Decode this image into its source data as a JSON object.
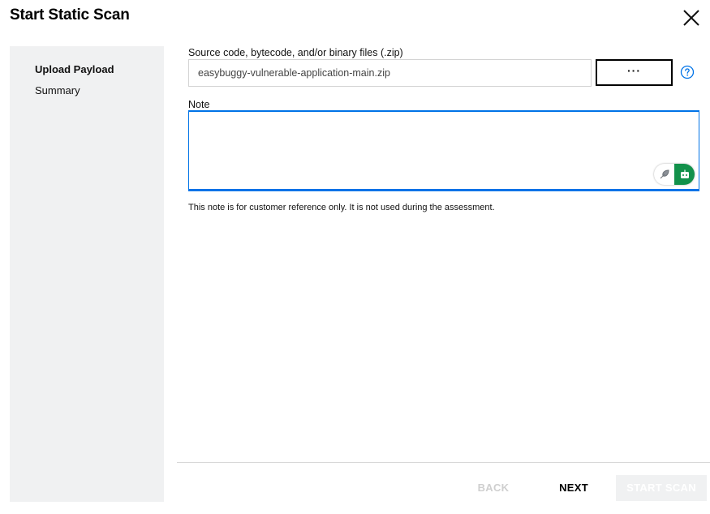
{
  "dialog": {
    "title": "Start Static Scan",
    "close_icon": "close-icon"
  },
  "sidebar": {
    "items": [
      {
        "label": "Upload Payload",
        "active": true
      },
      {
        "label": "Summary",
        "active": false
      }
    ]
  },
  "upload": {
    "label": "Source code, bytecode, and/or binary files (.zip)",
    "file_value": "easybuggy-vulnerable-application-main.zip",
    "browse_label": "···",
    "help_icon": "question-circle-icon"
  },
  "note": {
    "label": "Note",
    "value": "",
    "hint": "This note is for customer reference only. It is not used during the assessment.",
    "extension_icons": [
      "feather-icon",
      "robot-icon"
    ]
  },
  "footer": {
    "back_label": "BACK",
    "next_label": "NEXT",
    "start_label": "START SCAN"
  },
  "colors": {
    "accent": "#0073e7",
    "sidebar_bg": "#f0f1f2",
    "extension_green": "#12914b",
    "disabled_text": "#cfcfcf"
  }
}
